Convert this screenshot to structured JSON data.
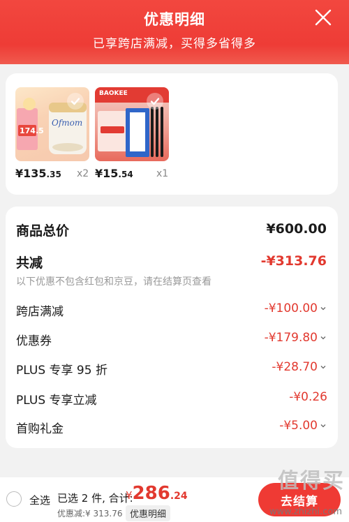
{
  "header": {
    "title": "优惠明细",
    "subtitle": "已享跨店满减，买得多省得多"
  },
  "products": [
    {
      "price_int": "¥135",
      "price_dec": ".35",
      "qty": "x2",
      "image": "milk-powder-image",
      "image_text": "Ofmom",
      "image_badge": "174.5"
    },
    {
      "price_int": "¥15",
      "price_dec": ".54",
      "qty": "x1",
      "image": "pen-set-image",
      "image_text": "BAOKEE",
      "image_badge": ""
    }
  ],
  "summary": {
    "total_label": "商品总价",
    "total_value": "¥600.00",
    "reduce_label": "共减",
    "reduce_value": "-¥313.76",
    "note": "以下优惠不包含红包和京豆，请在结算页查看"
  },
  "discounts": [
    {
      "label": "跨店满减",
      "value": "-¥100.00",
      "expandable": true
    },
    {
      "label": "优惠券",
      "value": "-¥179.80",
      "expandable": true
    },
    {
      "label": "PLUS 专享 95 折",
      "value": "-¥28.70",
      "expandable": true
    },
    {
      "label": "PLUS 专享立减",
      "value": "-¥0.26",
      "expandable": false
    },
    {
      "label": "首购礼金",
      "value": "-¥5.00",
      "expandable": true
    }
  ],
  "bottom": {
    "select_all": "全选",
    "selected": "已选 2 件, 合计:",
    "yen": "¥",
    "total_int": "286",
    "total_dec": ".24",
    "discount": "优惠减:¥ 313.76",
    "detail_button": "优惠明细",
    "checkout": "去结算"
  },
  "watermark": {
    "main": "值得买",
    "sub": "www.zhizhi.com"
  },
  "colors": {
    "accent": "#ef3a34",
    "header": "#f2473f",
    "price": "#e2392f"
  }
}
